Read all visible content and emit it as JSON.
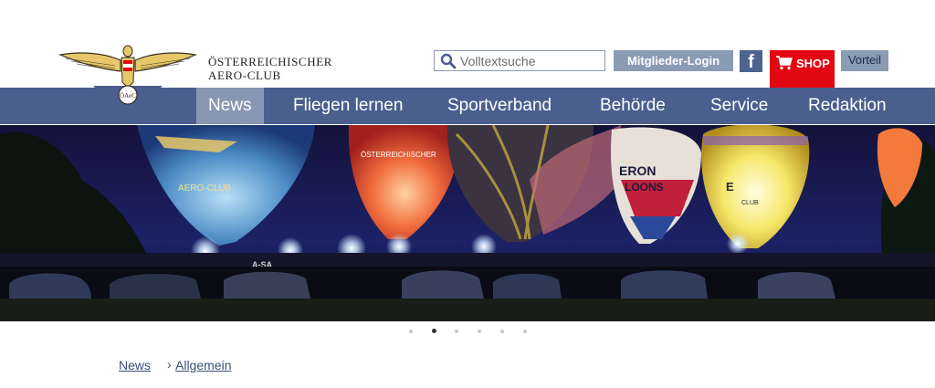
{
  "header": {
    "org_name_line1": "ÖSTERREICHISCHER",
    "org_name_line2": "AERO-CLUB",
    "logo_text": "ÖAeC",
    "search": {
      "placeholder": "Volltextsuche",
      "value": ""
    },
    "login_label": "Mitglieder-Login",
    "facebook_label": "f",
    "shop_label": "SHOP",
    "vorteil_label": "Vorteil"
  },
  "nav": {
    "items": [
      {
        "label": "News",
        "active": true
      },
      {
        "label": "Fliegen lernen",
        "active": false
      },
      {
        "label": "Sportverband",
        "active": false
      },
      {
        "label": "Behörde",
        "active": false
      },
      {
        "label": "Service",
        "active": false
      },
      {
        "label": "Redaktion",
        "active": false
      }
    ]
  },
  "hero": {
    "balloon_texts": [
      "AERO-CLUB",
      "ÖSTERREICHISCHER",
      "ERON",
      "LOONS",
      "E",
      "CLUB",
      "A-SA"
    ]
  },
  "slider": {
    "count": 6,
    "active_index": 1
  },
  "breadcrumb": {
    "items": [
      "News",
      "Allgemein"
    ]
  },
  "colors": {
    "nav_bg": "#4a5f8e",
    "nav_active": "#8797b3",
    "button_bg": "#8a9bb4",
    "shop_red": "#e30613",
    "facebook": "#4d6390"
  }
}
